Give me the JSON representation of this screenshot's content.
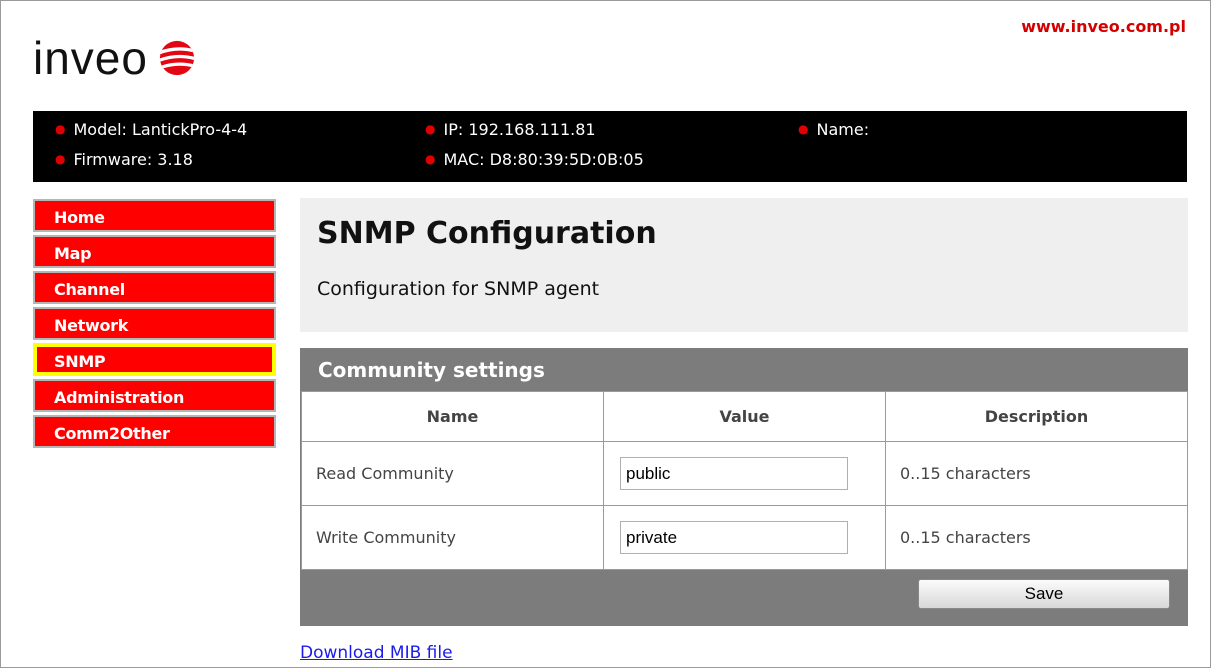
{
  "header": {
    "site_url": "www.inveo.com.pl",
    "logo_text": "inveo"
  },
  "device_info": {
    "model": "Model: LantickPro-4-4",
    "firmware": "Firmware: 3.18",
    "ip": "IP: 192.168.111.81",
    "mac": "MAC: D8:80:39:5D:0B:05",
    "name": "Name:"
  },
  "sidebar": {
    "items": [
      {
        "label": "Home"
      },
      {
        "label": "Map"
      },
      {
        "label": "Channel"
      },
      {
        "label": "Network"
      },
      {
        "label": "SNMP",
        "active": true
      },
      {
        "label": "Administration"
      },
      {
        "label": "Comm2Other"
      }
    ]
  },
  "page": {
    "title": "SNMP Configuration",
    "subtitle": "Configuration for SNMP agent"
  },
  "community": {
    "title": "Community settings",
    "columns": [
      "Name",
      "Value",
      "Description"
    ],
    "rows": [
      {
        "name": "Read Community",
        "value": "public",
        "description": "0..15 characters"
      },
      {
        "name": "Write Community",
        "value": "private",
        "description": "0..15 characters"
      }
    ],
    "save_label": "Save"
  },
  "footer": {
    "mib_link": "Download MIB file"
  },
  "colors": {
    "brand_red": "#ff0000",
    "active_highlight": "#ffff00",
    "panel_gray": "#7c7c7c"
  }
}
